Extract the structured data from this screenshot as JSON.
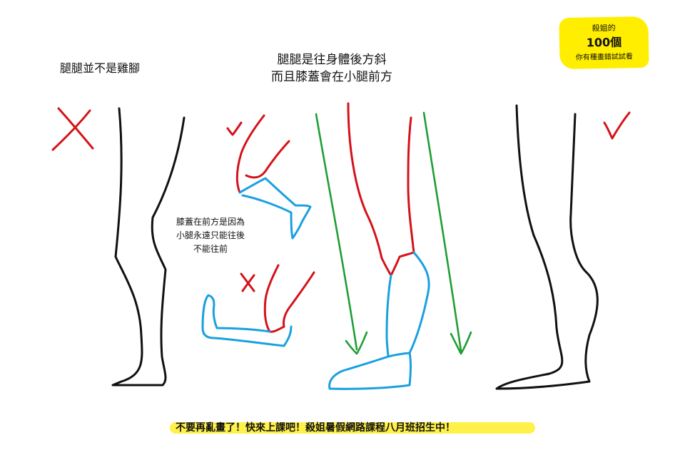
{
  "title_left": "腿腿並不是雞腳",
  "title_center": [
    "腿腿是往身體後方斜",
    "而且膝蓋會在小腿前方"
  ],
  "note": [
    "膝蓋在前方是因為",
    "小腿永遠只能往後",
    "不能往前"
  ],
  "badge": {
    "line1": "殺姐的",
    "line2": "100個",
    "line3": "你有種畫錯試試看",
    "color": "#ffee00"
  },
  "banner": "不要再亂畫了！快來上課吧！殺姐暑假網路課程八月班招生中！",
  "colors": {
    "outline": "#111111",
    "thigh": "#d4121a",
    "shin": "#1aa0e0",
    "arrow": "#1f9e35",
    "highlight": "#fff04a"
  }
}
